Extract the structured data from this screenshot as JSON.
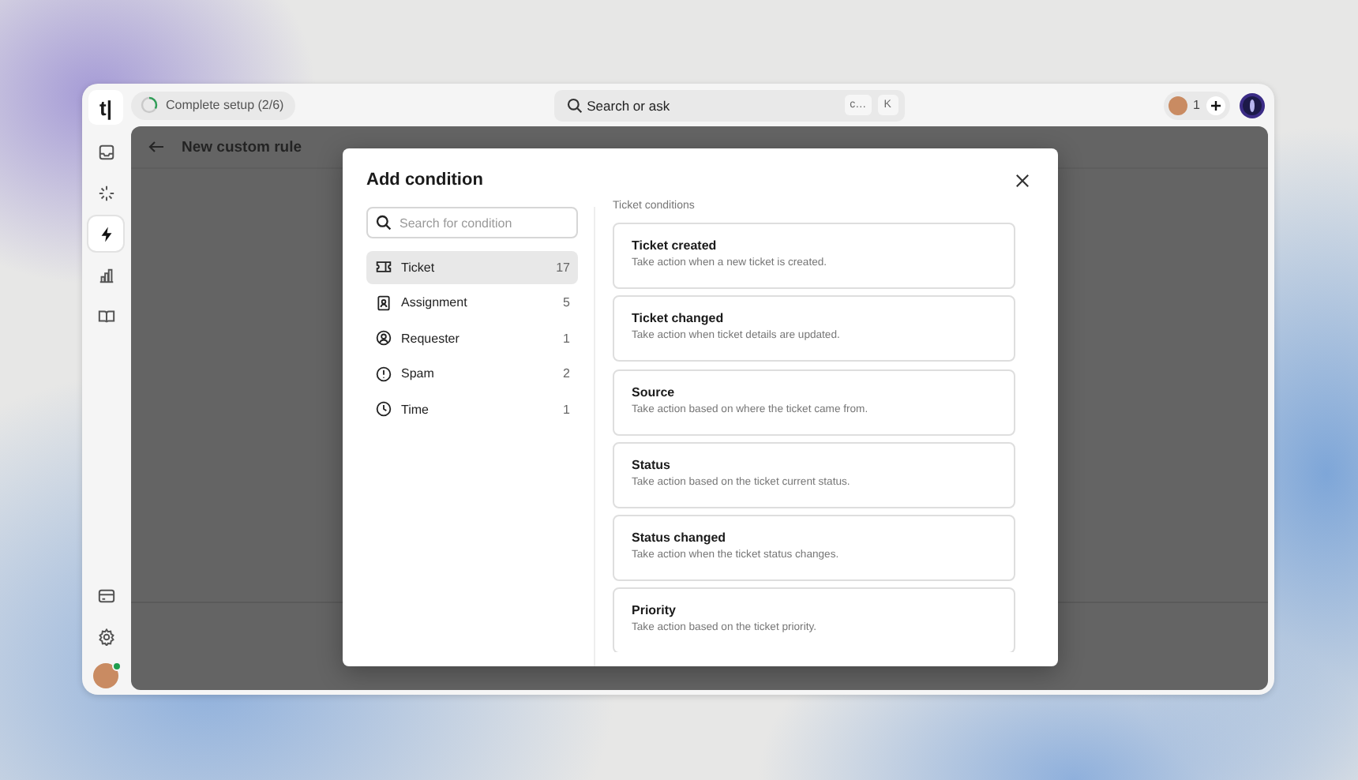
{
  "app": {
    "logo": "t|"
  },
  "topbar": {
    "setup": {
      "label": "Complete setup (2/6)",
      "level": 0.33
    },
    "search": {
      "placeholder": "Search or ask",
      "keys": [
        "c…",
        "K"
      ]
    },
    "members": {
      "count": "1"
    }
  },
  "sidebar": {
    "top": [
      {
        "kind": "inbox",
        "selected": false
      },
      {
        "kind": "sparkle",
        "selected": false
      },
      {
        "kind": "bolt",
        "selected": true
      },
      {
        "kind": "chart",
        "selected": false
      },
      {
        "kind": "book",
        "selected": false
      }
    ],
    "bottom": [
      {
        "kind": "card",
        "selected": false
      },
      {
        "kind": "gear",
        "selected": false
      }
    ]
  },
  "page": {
    "title": "New custom rule"
  },
  "modal": {
    "title": "Add condition",
    "search": {
      "placeholder": "Search for condition"
    },
    "categories": [
      {
        "kind": "ticket",
        "label": "Ticket",
        "count": "17",
        "selected": true
      },
      {
        "kind": "badge",
        "label": "Assignment",
        "count": "5",
        "selected": false
      },
      {
        "kind": "person",
        "label": "Requester",
        "count": "1",
        "selected": false
      },
      {
        "kind": "alert",
        "label": "Spam",
        "count": "2",
        "selected": false
      },
      {
        "kind": "clock",
        "label": "Time",
        "count": "1",
        "selected": false
      }
    ],
    "section_label": "Ticket conditions",
    "conditions": [
      {
        "title": "Ticket created",
        "description": "Take action when a new ticket is created."
      },
      {
        "title": "Ticket changed",
        "description": "Take action when ticket details are updated."
      },
      {
        "title": "Source",
        "description": "Take action based on where the ticket came from."
      },
      {
        "title": "Status",
        "description": "Take action based on the ticket current status."
      },
      {
        "title": "Status changed",
        "description": "Take action when the ticket status changes."
      },
      {
        "title": "Priority",
        "description": "Take action based on the ticket priority."
      }
    ]
  }
}
